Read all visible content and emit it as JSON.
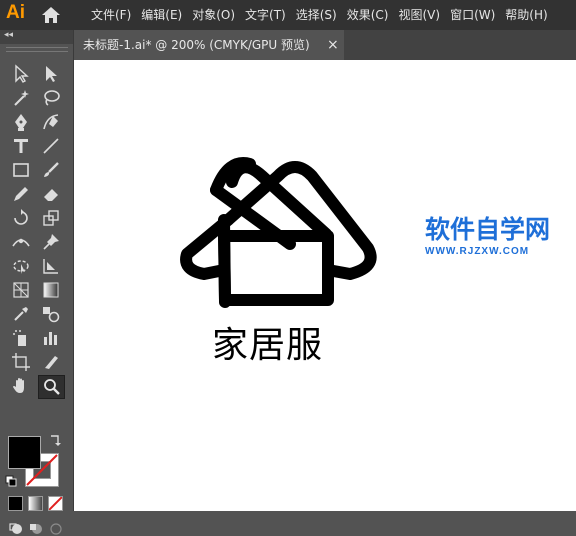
{
  "app": {
    "logo": "Ai"
  },
  "menu": [
    "文件(F)",
    "编辑(E)",
    "对象(O)",
    "文字(T)",
    "选择(S)",
    "效果(C)",
    "视图(V)",
    "窗口(W)",
    "帮助(H)"
  ],
  "document_tab": {
    "title": "未标题-1.ai* @ 200% (CMYK/GPU 预览)",
    "close": "×"
  },
  "toolbar": {
    "collapse": "◂◂",
    "tools": [
      "selection-tool",
      "direct-selection-tool",
      "magic-wand-tool",
      "lasso-tool",
      "pen-tool",
      "curvature-tool",
      "type-tool",
      "line-segment-tool",
      "rectangle-tool",
      "paintbrush-tool",
      "pencil-tool",
      "eraser-tool",
      "rotate-tool",
      "scale-tool",
      "width-tool",
      "puppet-warp-tool",
      "free-transform-tool",
      "shape-builder-tool",
      "perspective-grid-tool",
      "gradient-tool",
      "eyedropper-tool",
      "blend-tool",
      "symbol-sprayer-tool",
      "column-graph-tool",
      "artboard-tool",
      "slice-tool",
      "hand-tool",
      "zoom-tool"
    ],
    "active_tool": "zoom-tool",
    "fill_color": "#000000",
    "stroke": "none"
  },
  "canvas": {
    "brand_text": "家居服",
    "watermark_title": "软件自学网",
    "watermark_url": "WWW.RJZXW.COM"
  },
  "colors": {
    "app_accent": "#FF9A00",
    "watermark": "#1E6FD8",
    "panel": "#535353",
    "menubar": "#323232"
  }
}
